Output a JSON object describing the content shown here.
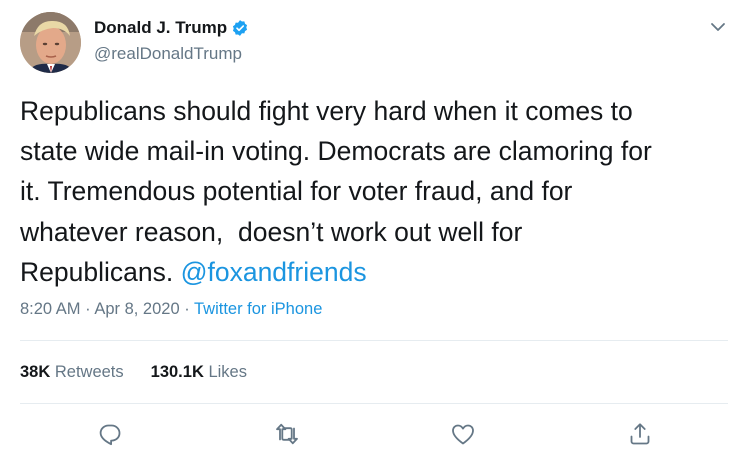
{
  "tweet": {
    "author": {
      "display_name": "Donald J. Trump",
      "handle": "@realDonaldTrump",
      "verified": true,
      "avatar_icon": "profile-photo"
    },
    "text_lines": [
      "Republicans should fight very hard when it comes to",
      "state wide mail-in voting. Democrats are clamoring for",
      "it. Tremendous potential for voter fraud, and for",
      "whatever reason,  doesn’t work out well for",
      "Republicans. "
    ],
    "mention": "@foxandfriends",
    "time": "8:20 AM",
    "separator": " · ",
    "date": "Apr 8, 2020",
    "source": "Twitter for iPhone",
    "retweets": {
      "count": "38K",
      "label": " Retweets"
    },
    "likes": {
      "count": "130.1K",
      "label": " Likes"
    },
    "actions": [
      "reply-icon",
      "retweet-icon",
      "like-icon",
      "share-icon"
    ],
    "colors": {
      "link": "#1b95e0",
      "secondary_text": "#657786",
      "icon": "#657786",
      "verified_badge": "#1da1f2"
    }
  }
}
